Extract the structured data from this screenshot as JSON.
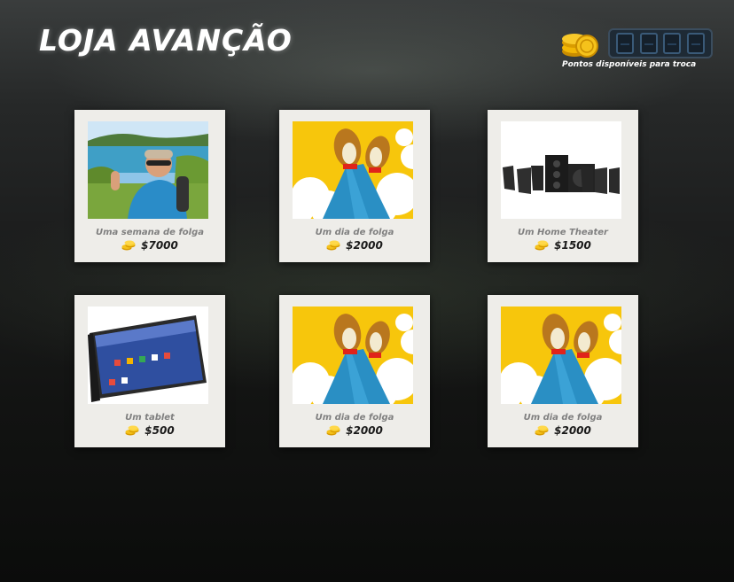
{
  "header": {
    "title": "LOJA AVANÇÃO",
    "points_label": "Pontos disponíveis para troca",
    "points_value": ""
  },
  "icons": {
    "coin": "coin-stack-icon"
  },
  "colors": {
    "coin": "#f2b705",
    "card_bg": "#eeede9",
    "counter_bg": "#1e2a35"
  },
  "items": [
    {
      "name": "Uma semana de folga",
      "price": "$7000",
      "image": "beach-selfie"
    },
    {
      "name": "Um dia de folga",
      "price": "$2000",
      "image": "feet-up-illustration"
    },
    {
      "name": "Um Home Theater",
      "price": "$1500",
      "image": "home-theater"
    },
    {
      "name": "Um tablet",
      "price": "$500",
      "image": "tablet"
    },
    {
      "name": "Um dia de folga",
      "price": "$2000",
      "image": "feet-up-illustration"
    },
    {
      "name": "Um dia de folga",
      "price": "$2000",
      "image": "feet-up-illustration"
    }
  ]
}
